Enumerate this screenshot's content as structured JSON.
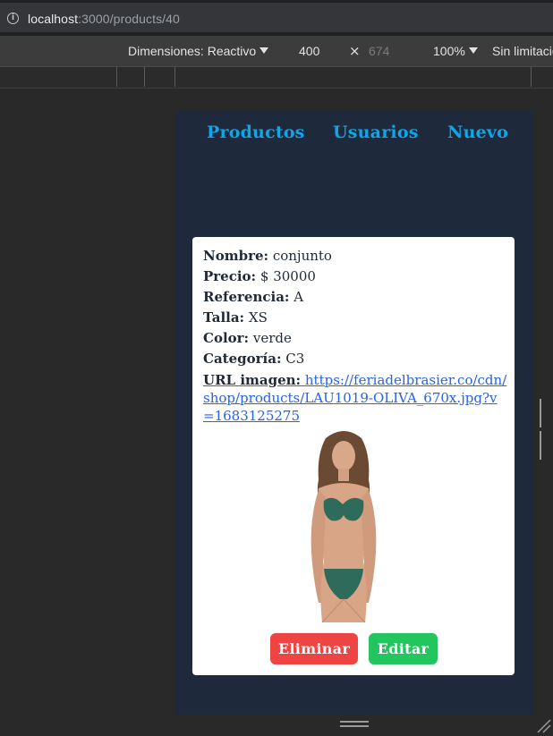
{
  "browser": {
    "url_host": "localhost",
    "url_path": ":3000/products/40",
    "info_icon": "i"
  },
  "devtools": {
    "dimensions_label": "Dimensiones: Reactivo",
    "width": "400",
    "height": "674",
    "zoom": "100%",
    "throttle": "Sin limitación",
    "times": "×"
  },
  "nav": {
    "products": "Productos",
    "users": "Usuarios",
    "new": "Nuevo"
  },
  "product": {
    "name_label": "Nombre:",
    "name": "conjunto",
    "price_label": "Precio:",
    "price": "$ 30000",
    "ref_label": "Referencia:",
    "ref": "A",
    "size_label": "Talla:",
    "size": "XS",
    "color_label": "Color:",
    "color": "verde",
    "category_label": "Categoría:",
    "category": "C3",
    "url_label": "URL imagen:",
    "url": "https://feriadelbrasier.co/cdn/shop/products/LAU1019-OLIVA_670x.jpg?v=1683125275"
  },
  "actions": {
    "delete": "Eliminar",
    "edit": "Editar"
  },
  "colors": {
    "viewport_bg": "#1e293b",
    "nav_link": "#0ea5e9",
    "delete_btn": "#ef4444",
    "edit_btn": "#22c55e",
    "link": "#2563eb"
  }
}
